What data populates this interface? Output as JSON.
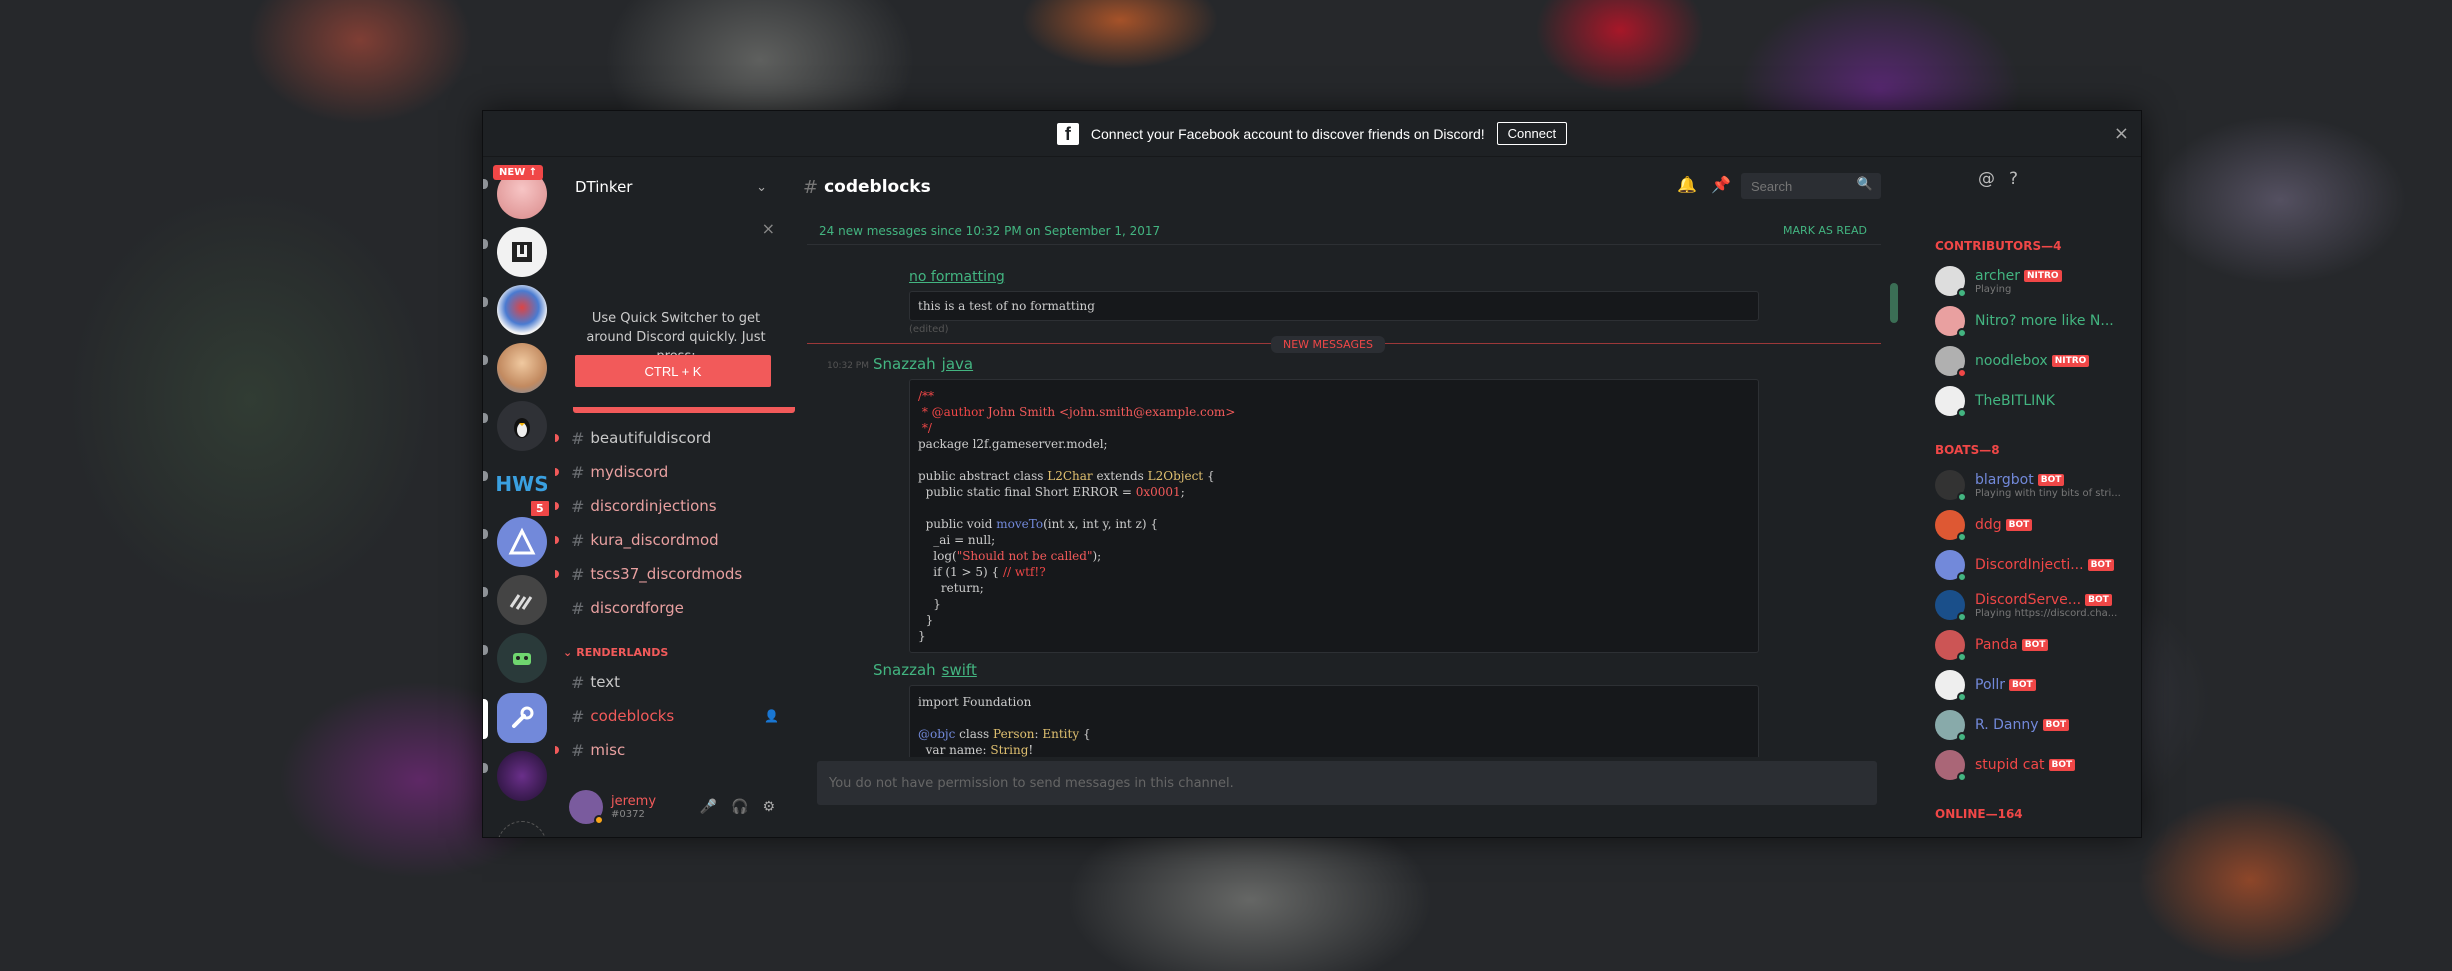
{
  "banner": {
    "fb_glyph": "f",
    "text": "Connect your Facebook account to discover friends on Discord!",
    "connect_label": "Connect",
    "close": "×"
  },
  "guilds": {
    "new_label": "NEW ↑",
    "hws_label": "HWS",
    "hws_badge": "5",
    "add_label": "+"
  },
  "server": {
    "name": "DTinker",
    "chevron": "⌄"
  },
  "quick_switcher": {
    "close": "×",
    "text": "Use Quick Switcher to get around Discord quickly. Just press:",
    "button": "CTRL + K"
  },
  "channels": [
    {
      "name": "beautifuldiscord"
    },
    {
      "name": "mydiscord"
    },
    {
      "name": "discordinjections"
    },
    {
      "name": "kura_discordmod"
    },
    {
      "name": "tscs37_discordmods"
    },
    {
      "name": "discordforge"
    }
  ],
  "category": {
    "name": "RENDERLANDS",
    "channels": [
      {
        "name": "text"
      },
      {
        "name": "codeblocks"
      },
      {
        "name": "misc"
      }
    ]
  },
  "user": {
    "name": "jeremy",
    "discriminator": "#0372"
  },
  "chat": {
    "channel": "codeblocks",
    "search_placeholder": "Search",
    "new_since": "24 new messages since 10:32 PM on September 1, 2017",
    "mark_read": "MARK AS READ",
    "msg1_link": "no formatting",
    "msg1_code": "this is a test of no formatting",
    "edited": "(edited)",
    "divider": "NEW MESSAGES",
    "timestamp": "10:32 PM",
    "author1": "Snazzah",
    "lang1": "java",
    "author2": "Snazzah",
    "lang2": "swift",
    "composer": "You do not have permission to send messages in this channel."
  },
  "java_code": {
    "l1": "/**",
    "l2_a": " * @author ",
    "l2_b": "John Smith <john.smith@example.com>",
    "l3": " */",
    "l4": "package l2f.gameserver.model;",
    "l5_a": "public abstract class ",
    "l5_b": "L2Char",
    "l5_c": " extends ",
    "l5_d": "L2Object",
    "l5_e": " {",
    "l6_a": "  public static final Short ERROR = ",
    "l6_b": "0x0001",
    "l6_c": ";",
    "l7_a": "  public void ",
    "l7_b": "moveTo",
    "l7_c": "(int x, int y, int z) {",
    "l8": "    _ai = null;",
    "l9_a": "    log(",
    "l9_b": "\"Should not be called\"",
    "l9_c": ");",
    "l10_a": "    if (1 > 5) { ",
    "l10_b": "// wtf!?",
    "l11": "      return;",
    "l12": "    }",
    "l13": "  }",
    "l14": "}"
  },
  "swift_code": {
    "l1": "import Foundation",
    "l2_a": "@objc",
    "l2_b": " class ",
    "l2_c": "Person",
    "l2_d": ": ",
    "l2_e": "Entity",
    "l2_f": " {",
    "l3_a": "  var name: ",
    "l3_b": "String",
    "l3_c": "!"
  },
  "members": {
    "contributors_title": "CONTRIBUTORS—4",
    "contributors": [
      {
        "name": "archer",
        "tag": "NITRO",
        "game": "Playing",
        "color": "#43b581"
      },
      {
        "name": "Nitro? more like N...",
        "tag": "",
        "game": "",
        "color": "#43b581"
      },
      {
        "name": "noodlebox",
        "tag": "NITRO",
        "game": "",
        "color": "#43b581"
      },
      {
        "name": "TheBITLINK",
        "tag": "",
        "game": "",
        "color": "#43b581"
      }
    ],
    "boats_title": "BOATS—8",
    "boats": [
      {
        "name": "blargbot",
        "tag": "BOT",
        "game": "Playing with tiny bits of stri...",
        "color": "#7289da"
      },
      {
        "name": "ddg",
        "tag": "BOT",
        "game": "",
        "color": "#f04747"
      },
      {
        "name": "DiscordInjecti...",
        "tag": "BOT",
        "game": "",
        "color": "#f04747"
      },
      {
        "name": "DiscordServe...",
        "tag": "BOT",
        "game": "Playing https://discord.cha...",
        "color": "#f04747"
      },
      {
        "name": "Panda",
        "tag": "BOT",
        "game": "",
        "color": "#f04747"
      },
      {
        "name": "Pollr",
        "tag": "BOT",
        "game": "",
        "color": "#7289da"
      },
      {
        "name": "R. Danny",
        "tag": "BOT",
        "game": "",
        "color": "#7289da"
      },
      {
        "name": "stupid cat",
        "tag": "BOT",
        "game": "",
        "color": "#f04747"
      }
    ],
    "online_title": "ONLINE—164"
  },
  "icons": {
    "bell": "🔔",
    "pin": "📌",
    "members": "👥",
    "search": "🔍",
    "mention": "@",
    "help": "?",
    "mic": "🎤",
    "headset": "🎧",
    "gear": "⚙",
    "add_member": "👤"
  }
}
